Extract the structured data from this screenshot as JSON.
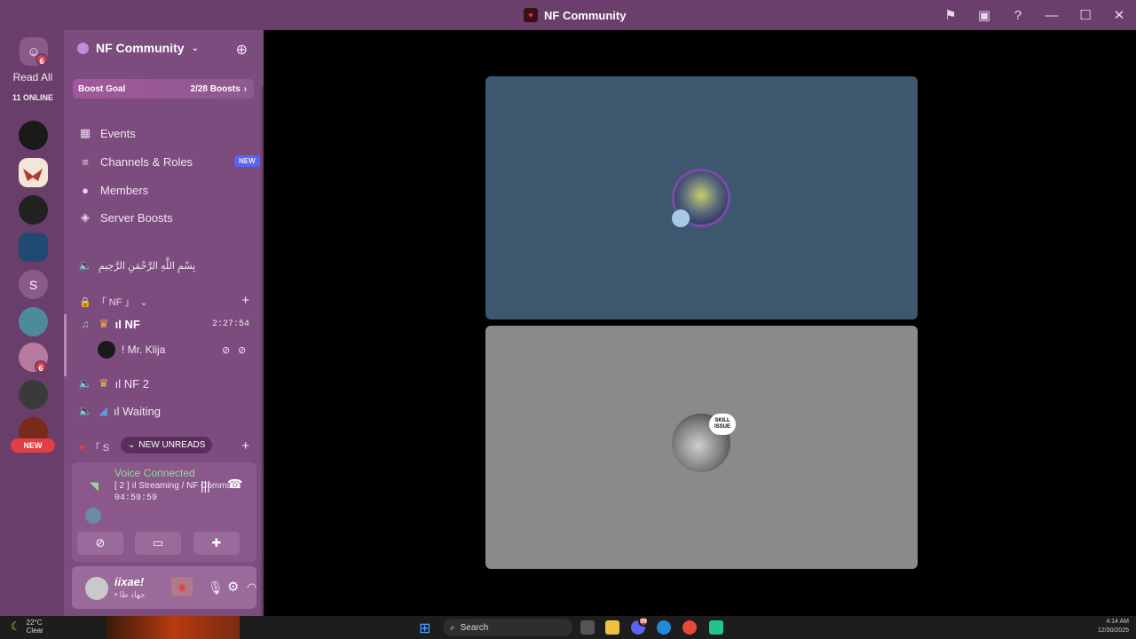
{
  "window": {
    "title": "NF Community"
  },
  "rail": {
    "dm_badge": "6",
    "read_all": "Read All",
    "online": "11 ONLINE",
    "server_s_label": "S",
    "server_badge": "6",
    "new_label": "NEW"
  },
  "server": {
    "name": "NF Community",
    "boost_goal_label": "Boost Goal",
    "boost_count": "2/28 Boosts",
    "menu": [
      {
        "label": "Events",
        "icon": "calendar-icon"
      },
      {
        "label": "Channels & Roles",
        "icon": "channels-icon",
        "badge": "NEW"
      },
      {
        "label": "Members",
        "icon": "members-icon"
      },
      {
        "label": "Server Boosts",
        "icon": "boost-icon"
      }
    ],
    "bismillah": "بِسْمِ اللَّهِ الرَّحْمَنِ الرَّحِيمِ",
    "category": "「 NF 」",
    "channels": [
      {
        "name": "ıl NF",
        "duration": "2:27:54"
      },
      {
        "name": "ıl NF 2"
      },
      {
        "name": "ıl Waiting"
      }
    ],
    "voice_user": "! Mr. Klija",
    "category2": "「 S",
    "new_unreads": "NEW UNREADS"
  },
  "voice": {
    "status": "Voice Connected",
    "channel": "[ 2 ] ıl Streaming / NF Commu...",
    "elapsed": "04:59:59"
  },
  "user": {
    "name": "iixae!",
    "status": "• جهاد طا"
  },
  "stage": {
    "skill_issue": "SKILL ISSUE"
  },
  "taskbar": {
    "temp": "22°C",
    "condition": "Clear",
    "search": "Search",
    "time": "4:14 AM",
    "date": "12/30/2025",
    "discord_badge": "99"
  },
  "colors": {
    "titlebar": "#6b3f6c",
    "sidebar": "#7d4c7e",
    "tile_blue": "#3d586e",
    "tile_gray": "#8a8a8a",
    "voice_green": "#8fdc92"
  }
}
